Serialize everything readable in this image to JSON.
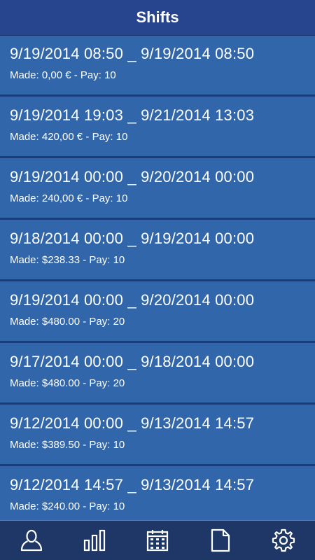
{
  "header": {
    "title": "Shifts"
  },
  "shifts": [
    {
      "range": "9/19/2014 08:50 _ 9/19/2014 08:50",
      "made": "Made: 0,00 € - Pay: 10"
    },
    {
      "range": "9/19/2014 19:03 _ 9/21/2014 13:03",
      "made": "Made: 420,00 € - Pay: 10"
    },
    {
      "range": "9/19/2014 00:00 _ 9/20/2014 00:00",
      "made": "Made: 240,00 € - Pay: 10"
    },
    {
      "range": "9/18/2014 00:00 _ 9/19/2014 00:00",
      "made": "Made: $238.33 - Pay: 10"
    },
    {
      "range": "9/19/2014 00:00 _ 9/20/2014 00:00",
      "made": "Made: $480.00 - Pay: 20"
    },
    {
      "range": "9/17/2014 00:00 _ 9/18/2014 00:00",
      "made": "Made: $480.00 - Pay: 20"
    },
    {
      "range": "9/12/2014 00:00 _ 9/13/2014 14:57",
      "made": "Made: $389.50 - Pay: 10"
    },
    {
      "range": "9/12/2014 14:57 _ 9/13/2014 14:57",
      "made": "Made: $240.00 - Pay: 10"
    }
  ],
  "tabbar": {
    "icons": [
      "profile-icon",
      "bar-chart-icon",
      "calendar-icon",
      "document-icon",
      "gear-icon"
    ]
  },
  "colors": {
    "header_bg": "#27458f",
    "row_bg": "#3166aa",
    "row_separator": "#1e3b72",
    "tabbar_bg": "#1e3766",
    "text": "#ffffff"
  }
}
